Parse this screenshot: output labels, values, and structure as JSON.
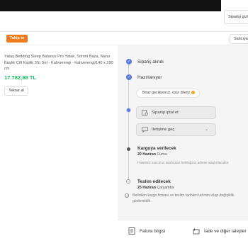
{
  "header": {
    "order_detail_button": "Siparişi gizle"
  },
  "seller": {
    "follow_button": "Takip et",
    "seller_button": "Satıcıya sor"
  },
  "product": {
    "name": "Yataş Bedding Sleep Balance Pro Yatak, Somni Baza, Nano Başlık Çift Kişilik 3'lü Set - Kahverengi - Kahverengi/140 x 190 cm",
    "price": "17.782,68 TL",
    "review_button": "Tekrar al"
  },
  "timeline": {
    "steps": [
      {
        "title": "Sipariş alındı"
      },
      {
        "title": "Hazırlanıyor"
      },
      {
        "title": "Kargoya verilecek",
        "date_day": "20 Haziran",
        "date_weekday": "Cuma",
        "note": "Paketiniz satıcımız tarafından belirttiğiniz adrese ulaştırılacaktır."
      },
      {
        "title": "Teslim edilecek",
        "date_day": "25 Haziran",
        "date_weekday": "Çarşamba"
      }
    ],
    "sorry_message": "Biraz gecikiyoruz, özür dileriz",
    "cancel_button": "Siparişi iptal et",
    "contact_button": "İletişime geç",
    "info_text": "Belirtilen kargo firması ve teslim tarihleri tahmini olup değişiklik gösterebilir."
  },
  "footer": {
    "invoice": "Fatura bilgisi",
    "returns": "İade ve diğer talepler"
  },
  "colors": {
    "accent": "#f27a1a",
    "price": "#0bc15c",
    "timeline": "#5c7cd6"
  }
}
